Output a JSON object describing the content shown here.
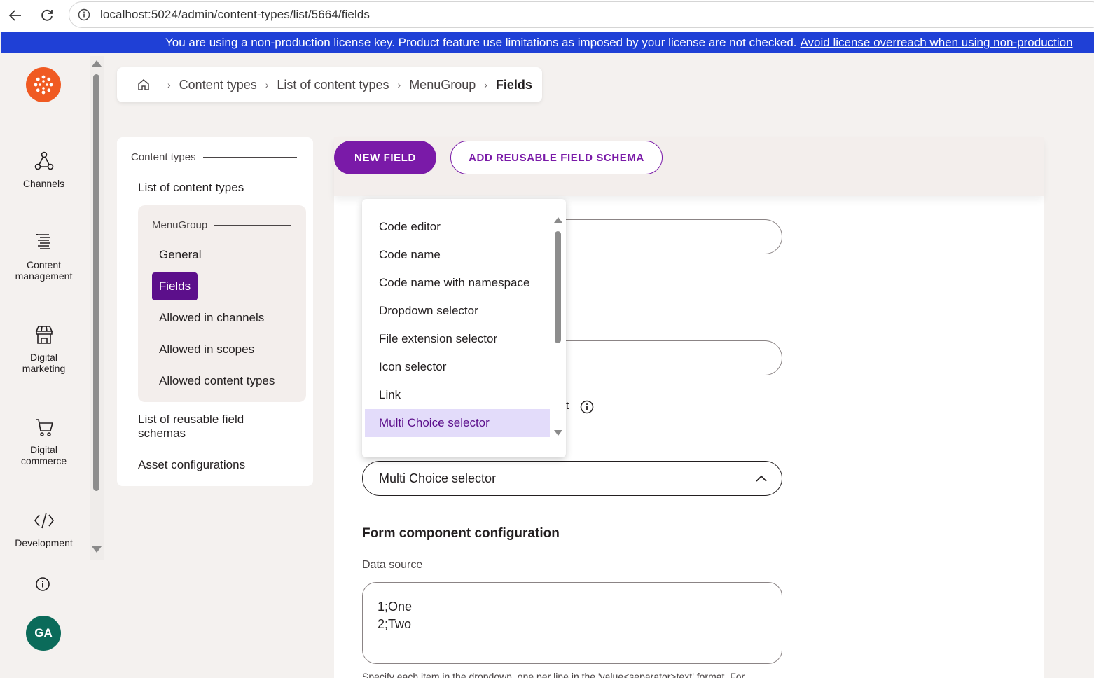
{
  "browser": {
    "url": "localhost:5024/admin/content-types/list/5664/fields"
  },
  "license": {
    "message": "You are using a non-production license key. Product feature use limitations as imposed by your license are not checked.",
    "link": "Avoid license overreach when using non-production"
  },
  "rail": {
    "items": [
      {
        "label": "Channels",
        "icon": "channels-icon"
      },
      {
        "label": "Content management",
        "icon": "content-management-icon"
      },
      {
        "label": "Digital marketing",
        "icon": "store-icon"
      },
      {
        "label": "Digital commerce",
        "icon": "cart-icon"
      },
      {
        "label": "Development",
        "icon": "code-icon"
      }
    ],
    "avatar": "GA"
  },
  "breadcrumb": {
    "items": [
      "Content types",
      "List of content types",
      "MenuGroup",
      "Fields"
    ]
  },
  "sidenav": {
    "heading": "Content types",
    "list_link": "List of content types",
    "group_heading": "MenuGroup",
    "group_items": [
      "General",
      "Fields",
      "Allowed in channels",
      "Allowed in scopes",
      "Allowed content types"
    ],
    "reusable_schemas": "List of reusable field schemas",
    "asset_configurations": "Asset configurations"
  },
  "toolbar": {
    "new_field": "NEW FIELD",
    "add_reusable": "ADD REUSABLE FIELD SCHEMA"
  },
  "dropdown": {
    "options": [
      "Code editor",
      "Code name",
      "Code name with namespace",
      "Dropdown selector",
      "File extension selector",
      "Icon selector",
      "Link",
      "Multi Choice selector"
    ],
    "selected": "Multi Choice selector"
  },
  "form": {
    "partial_label_fragment": "t",
    "component_select_value": "Multi Choice selector",
    "section_title": "Form component configuration",
    "data_source_label": "Data source",
    "data_source_lines": [
      "1;One",
      "2;Two"
    ],
    "hint": "Specify each item in the dropdown, one per line in the 'value<separator>text' format. For"
  },
  "colors": {
    "brand_purple": "#7a1aa8",
    "active_nav": "#5c0f8b",
    "license_blue": "#1f40d6",
    "logo_orange": "#f05a22",
    "avatar_green": "#0b6b5a",
    "selected_option_bg": "#e3dcfa"
  }
}
